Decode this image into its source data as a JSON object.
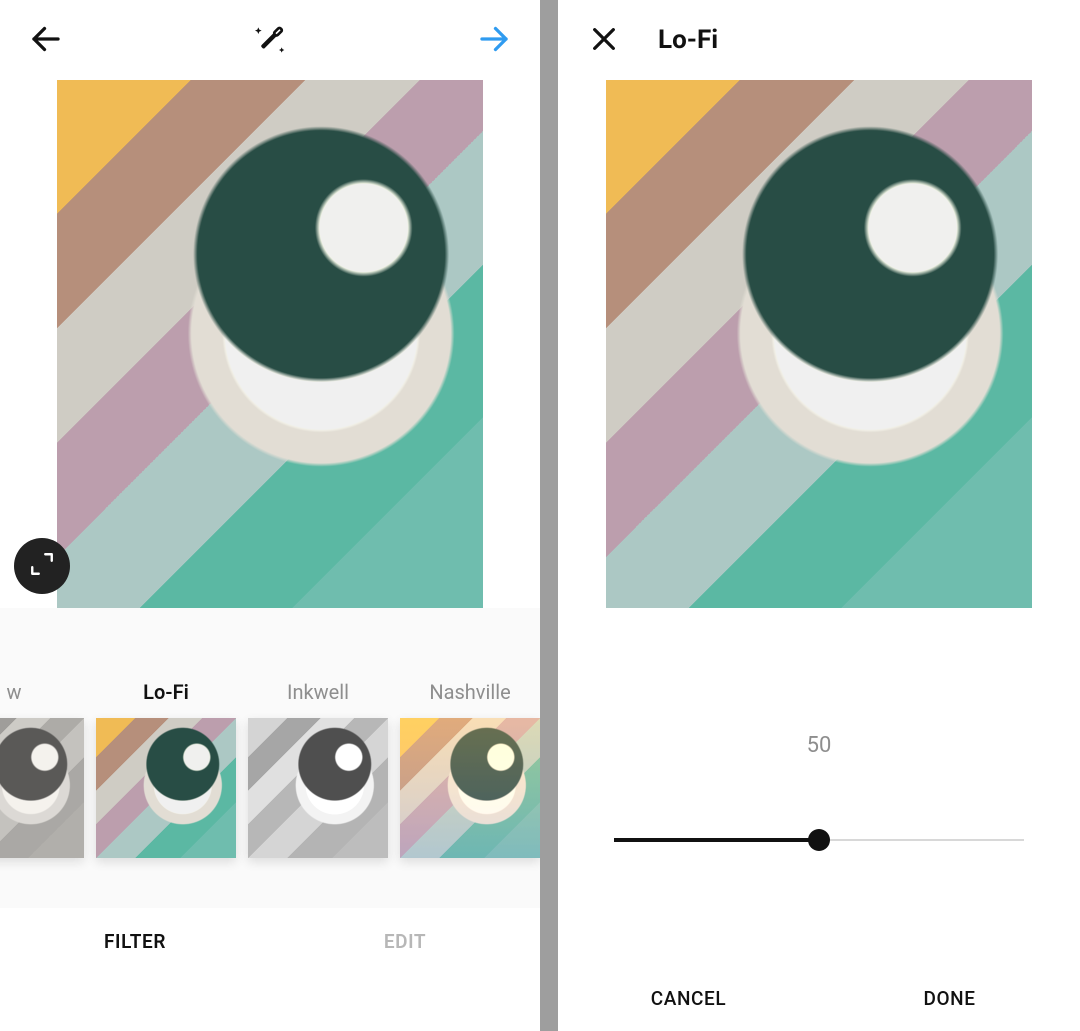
{
  "left": {
    "filters": [
      {
        "name": "Willow",
        "label_visible": "w",
        "style": "willow",
        "selected": false
      },
      {
        "name": "Lo-Fi",
        "label_visible": "Lo-Fi",
        "style": "lofi",
        "selected": true
      },
      {
        "name": "Inkwell",
        "label_visible": "Inkwell",
        "style": "inkwell",
        "selected": false
      },
      {
        "name": "Nashville",
        "label_visible": "Nashville",
        "style": "nashville",
        "selected": false
      }
    ],
    "tabs": {
      "filter": "FILTER",
      "edit": "EDIT",
      "active": "filter"
    }
  },
  "right": {
    "title": "Lo-Fi",
    "slider": {
      "value": 50,
      "min": 0,
      "max": 100,
      "value_label": "50"
    },
    "actions": {
      "cancel": "CANCEL",
      "done": "DONE"
    }
  },
  "colors": {
    "accent_blue": "#2F9BF0"
  }
}
